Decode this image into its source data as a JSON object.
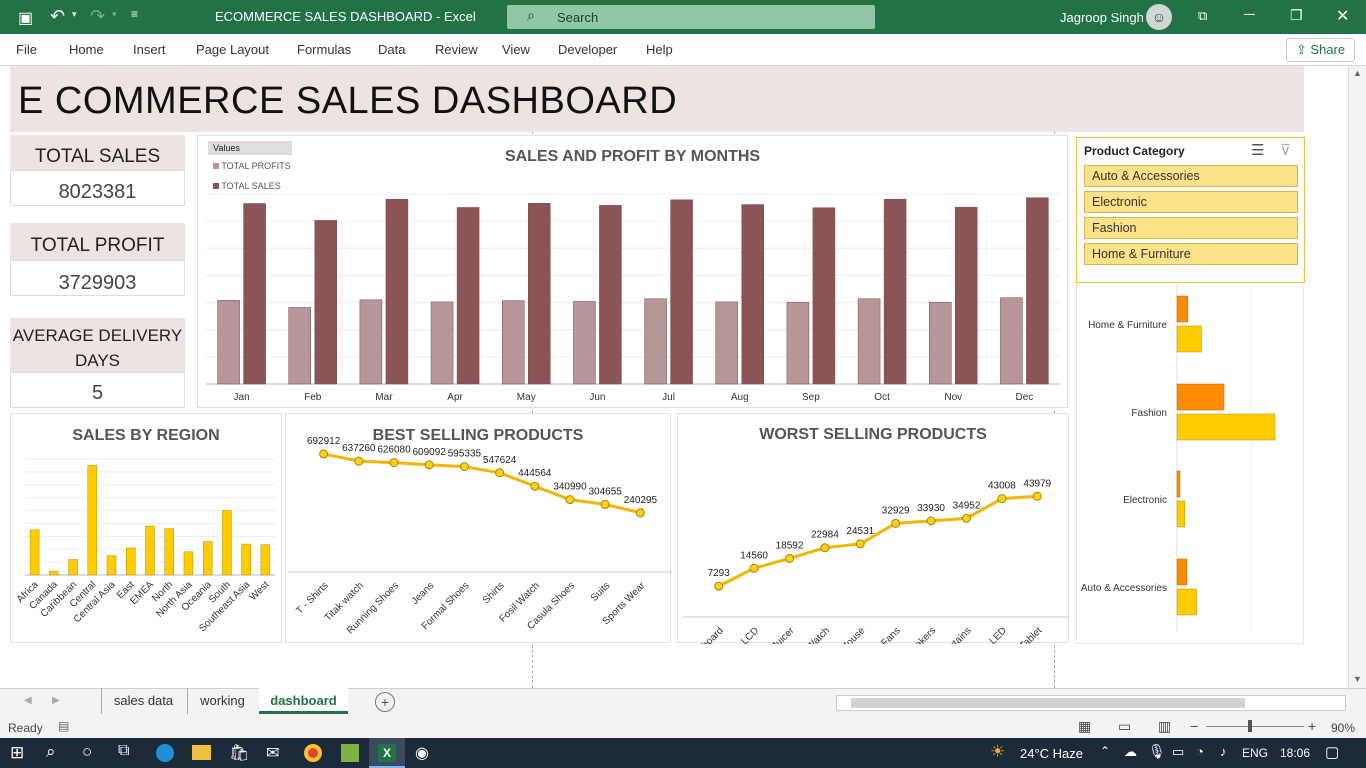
{
  "titlebar": {
    "doc_title": "ECOMMERCE SALES DASHBOARD  -  Excel",
    "search_placeholder": "Search",
    "user_name": "Jagroop Singh"
  },
  "ribbon": {
    "tabs": [
      "File",
      "Home",
      "Insert",
      "Page Layout",
      "Formulas",
      "Data",
      "Review",
      "View",
      "Developer",
      "Help"
    ],
    "share_label": "Share"
  },
  "dashboard": {
    "title": "E COMMERCE SALES DASHBOARD",
    "kpis": [
      {
        "label": "TOTAL SALES",
        "value": "8023381"
      },
      {
        "label": "TOTAL PROFIT",
        "value": "3729903"
      },
      {
        "label": "AVERAGE DELIVERY DAYS",
        "value": "5"
      }
    ]
  },
  "slicer": {
    "title": "Product Category",
    "items": [
      "Auto & Accessories",
      "Electronic",
      "Fashion",
      "Home & Furniture"
    ]
  },
  "sheet_tabs": {
    "tabs": [
      "sales data",
      "working",
      "dashboard"
    ],
    "active": "dashboard"
  },
  "status": {
    "ready": "Ready",
    "zoom": "90%"
  },
  "taskbar": {
    "weather": "24°C  Haze",
    "lang": "ENG",
    "time": "18:06"
  },
  "chart_data": [
    {
      "type": "bar",
      "title": "SALES AND PROFIT BY MONTHS",
      "legend_title": "Values",
      "legend_position": "top-left",
      "categories": [
        "Jan",
        "Feb",
        "Mar",
        "Apr",
        "May",
        "Jun",
        "Jul",
        "Aug",
        "Sep",
        "Oct",
        "Nov",
        "Dec"
      ],
      "series": [
        {
          "name": "TOTAL PROFITS",
          "color": "#b69696",
          "values": [
            317000,
            290000,
            319000,
            311000,
            316000,
            313000,
            323000,
            311000,
            310000,
            323000,
            310000,
            327000
          ]
        },
        {
          "name": "TOTAL SALES",
          "color": "#8b5558",
          "values": [
            684000,
            620000,
            700000,
            669000,
            685000,
            677000,
            698000,
            680000,
            668000,
            700000,
            670000,
            706000
          ]
        }
      ],
      "ylim": [
        0,
        720000
      ]
    },
    {
      "type": "bar",
      "title": "SALES BY REGION",
      "categories": [
        "Africa",
        "Canada",
        "Caribbean",
        "Central",
        "Central Asia",
        "East",
        "EMEA",
        "North",
        "North Asia",
        "Oceania",
        "South",
        "Southeast Asia",
        "West"
      ],
      "values": [
        350000,
        30000,
        120000,
        850000,
        150000,
        210000,
        380000,
        360000,
        180000,
        260000,
        500000,
        240000,
        235000
      ],
      "ylim": [
        0,
        900000
      ],
      "color": "#ffcc00"
    },
    {
      "type": "line",
      "title": "BEST SELLING PRODUCTS",
      "categories": [
        "T - Shirts",
        "Titak watch",
        "Running Shoes",
        "Jeans",
        "Formal Shoes",
        "Shirts",
        "Fosil Watch",
        "Casula Shoes",
        "Suits",
        "Sports Wear"
      ],
      "values": [
        692912,
        637260,
        626080,
        609092,
        595335,
        547624,
        444564,
        340990,
        304655,
        240295
      ],
      "ylim": [
        0,
        1000000
      ],
      "color": "#f2b600"
    },
    {
      "type": "line",
      "title": "WORST SELLING PRODUCTS",
      "categories": [
        "Keyboard",
        "LCD",
        "Mixer/Juicer",
        "Watch",
        "Mouse",
        "Fans",
        "Speakers",
        "Curtains",
        "LED",
        "Tablet"
      ],
      "values": [
        7293,
        14560,
        18592,
        22984,
        24531,
        32929,
        33930,
        34952,
        43008,
        43979
      ],
      "ylim": [
        0,
        60000
      ],
      "color": "#f2b600"
    },
    {
      "type": "bar",
      "orientation": "horizontal",
      "categories": [
        "Auto & Accessories",
        "Electronic",
        "Fashion",
        "Home & Furniture"
      ],
      "series": [
        {
          "name": "",
          "color": "#ffcc00",
          "values": [
            0.2,
            0.08,
            1.0,
            0.25
          ]
        },
        {
          "name": "",
          "color": "#ff8c00",
          "values": [
            0.1,
            0.03,
            0.48,
            0.11
          ]
        }
      ]
    }
  ]
}
